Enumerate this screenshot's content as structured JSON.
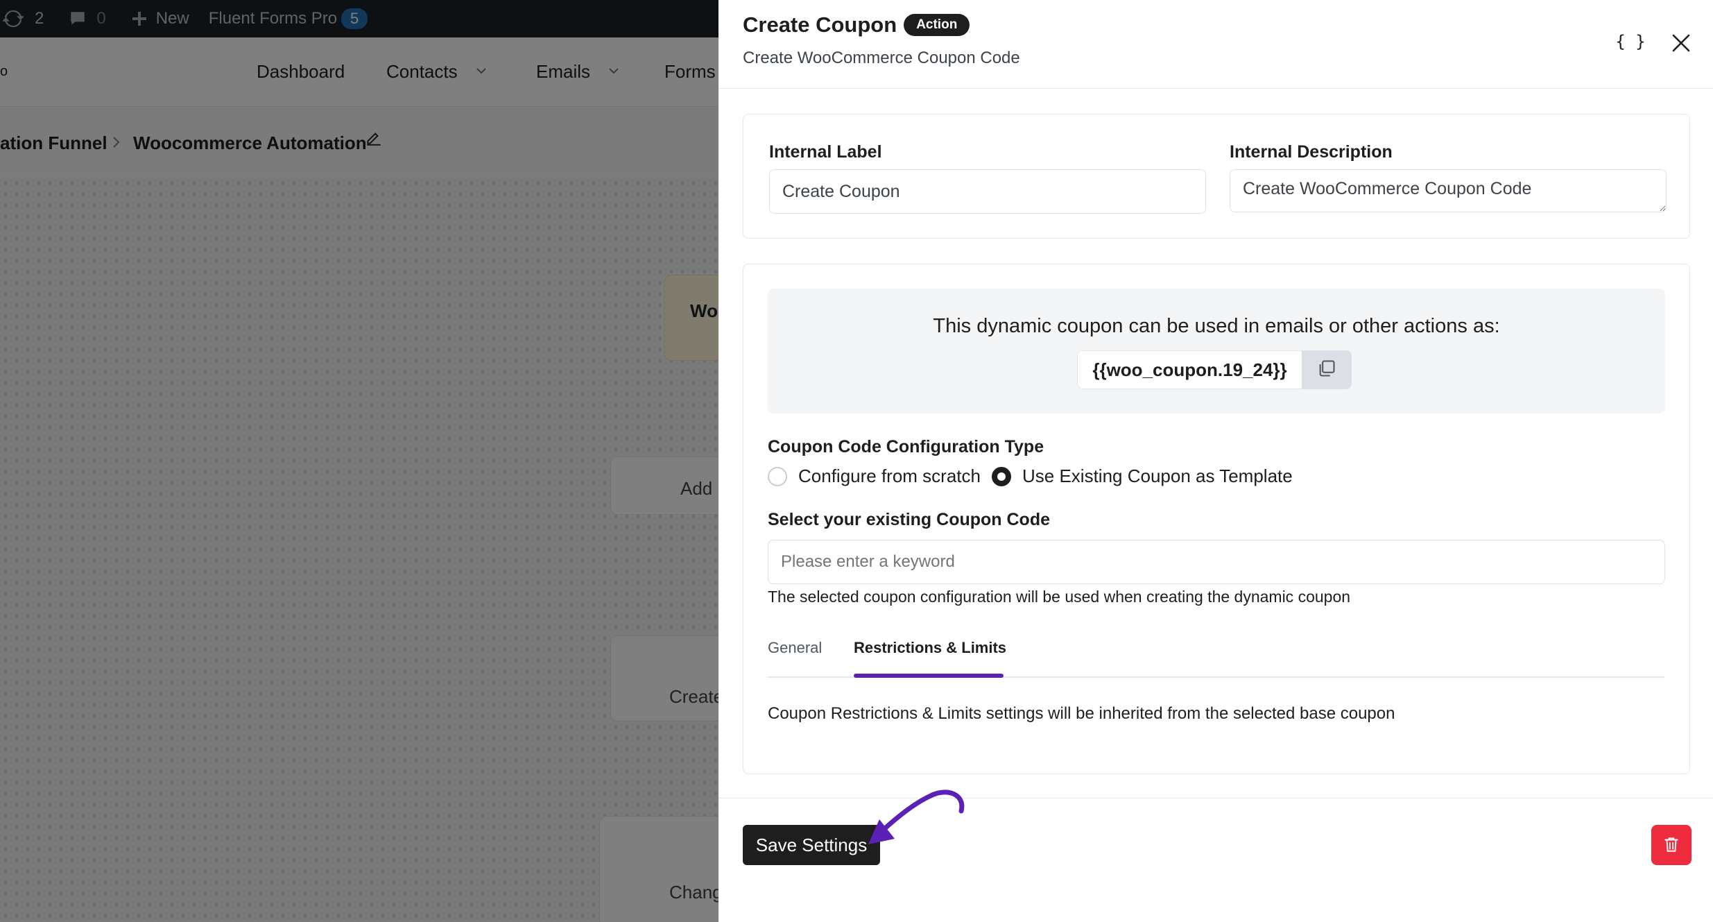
{
  "admin_bar": {
    "updates_count": "2",
    "comments_count": "0",
    "new_label": "New",
    "plugin_label": "Fluent Forms Pro",
    "plugin_badge": "5"
  },
  "top_nav": {
    "left_fragment": "o",
    "items": [
      {
        "label": "Dashboard"
      },
      {
        "label": "Contacts"
      },
      {
        "label": "Emails"
      },
      {
        "label": "Forms"
      }
    ]
  },
  "breadcrumb": {
    "parent": "ation Funnel",
    "current": "Woocommerce Automation"
  },
  "canvas_nodes": {
    "trigger": "Wo",
    "add": "Add",
    "create": "Create",
    "change": "Chang"
  },
  "drawer": {
    "title": "Create Coupon",
    "badge": "Action",
    "subtitle": "Create WooCommerce Coupon Code",
    "code_button": "{ }",
    "internal_label": {
      "label": "Internal Label",
      "value": "Create Coupon"
    },
    "internal_description": {
      "label": "Internal Description",
      "value": "Create WooCommerce Coupon Code"
    },
    "info": {
      "text": "This dynamic coupon can be used in emails or other actions as:",
      "smartcode": "{{woo_coupon.19_24}}"
    },
    "config_type": {
      "label": "Coupon Code Configuration Type",
      "options": [
        {
          "label": "Configure from scratch",
          "checked": false
        },
        {
          "label": "Use Existing Coupon as Template",
          "checked": true
        }
      ]
    },
    "existing_coupon": {
      "label": "Select your existing Coupon Code",
      "placeholder": "Please enter a keyword",
      "help": "The selected coupon configuration will be used when creating the dynamic coupon"
    },
    "tabs": [
      {
        "label": "General",
        "active": false
      },
      {
        "label": "Restrictions & Limits",
        "active": true
      }
    ],
    "restrictions_note": "Coupon Restrictions & Limits settings will be inherited from the selected base coupon",
    "save_label": "Save Settings"
  },
  "colors": {
    "accent": "#5b21b6",
    "dark": "#1e1e1e",
    "danger": "#ef2b3e",
    "admin_bar": "#1d2327"
  }
}
